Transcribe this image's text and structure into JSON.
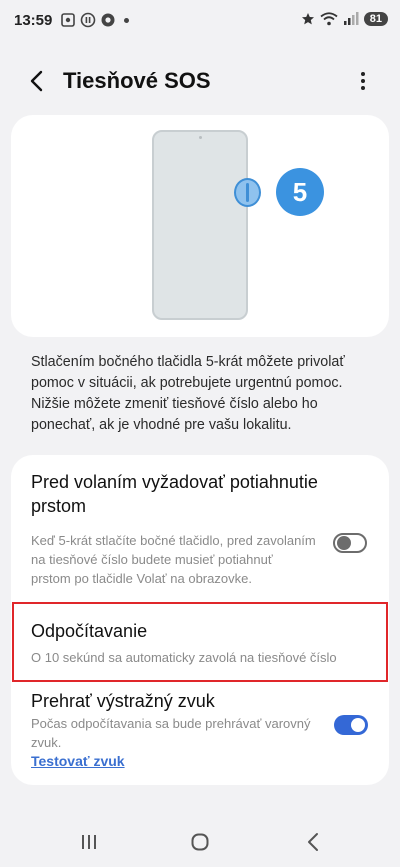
{
  "status_bar": {
    "time": "13:59",
    "battery": "81"
  },
  "header": {
    "title": "Tiesňové SOS"
  },
  "illustration": {
    "press_count": "5"
  },
  "description": "Stlačením bočného tlačidla 5-krát môžete privolať pomoc v situácii, ak potrebujete urgentnú pomoc. Nižšie môžete zmeniť tiesňové číslo alebo ho ponechať, ak je vhodné pre vašu lokalitu.",
  "settings": {
    "require_swipe": {
      "title": "Pred volaním vyžadovať potiahnutie prstom",
      "subtitle": "Keď 5-krát stlačíte bočné tlačidlo, pred zavolaním na tiesňové číslo budete musieť potiahnuť prstom po tlačidle Volať na obrazovke.",
      "enabled": false
    },
    "countdown": {
      "title": "Odpočítavanie",
      "subtitle": "O 10 sekúnd sa automaticky zavolá na tiesňové číslo"
    },
    "warning_sound": {
      "title": "Prehrať výstražný zvuk",
      "subtitle": "Počas odpočítavania sa bude prehrávať varovný zvuk.",
      "enabled": true,
      "test_link": "Testovať zvuk"
    }
  },
  "colors": {
    "accent": "#3468d6",
    "illustration_blue": "#3b93e0",
    "highlight": "#e0262a"
  }
}
